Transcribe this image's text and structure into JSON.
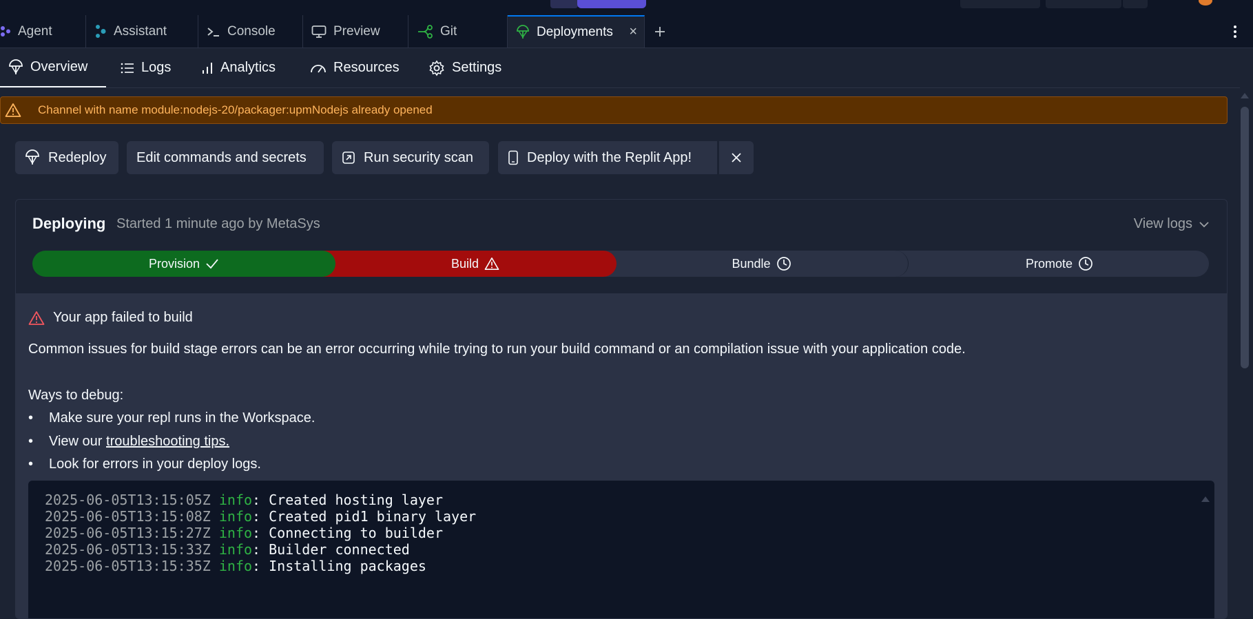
{
  "tabs": [
    {
      "label": "Agent",
      "icon": "agent-icon"
    },
    {
      "label": "Assistant",
      "icon": "assistant-icon"
    },
    {
      "label": "Console",
      "icon": "terminal-icon"
    },
    {
      "label": "Preview",
      "icon": "monitor-icon"
    },
    {
      "label": "Git",
      "icon": "git-icon"
    },
    {
      "label": "Deployments",
      "icon": "deployments-icon",
      "active": true
    }
  ],
  "subnav": [
    {
      "label": "Overview",
      "icon": "deployments-icon",
      "active": true
    },
    {
      "label": "Logs",
      "icon": "list-icon"
    },
    {
      "label": "Analytics",
      "icon": "bar-chart-icon"
    },
    {
      "label": "Resources",
      "icon": "gauge-icon"
    },
    {
      "label": "Settings",
      "icon": "gear-icon"
    }
  ],
  "banner": {
    "message": "Channel with name module:nodejs-20/packager:upmNodejs already opened",
    "color": "#5c3000"
  },
  "actions": {
    "redeploy": "Redeploy",
    "edit": "Edit commands and secrets",
    "scan": "Run security scan",
    "app": "Deploy with the Replit App!"
  },
  "deployment": {
    "status": "Deploying",
    "started": "Started 1 minute ago by MetaSys",
    "view_logs": "View logs",
    "stages": [
      {
        "label": "Provision",
        "state": "success",
        "color": "#0d6b1f"
      },
      {
        "label": "Build",
        "state": "error",
        "color": "#a30c0c"
      },
      {
        "label": "Bundle",
        "state": "pending"
      },
      {
        "label": "Promote",
        "state": "pending"
      }
    ]
  },
  "error": {
    "title": "Your app failed to build",
    "body": "Common issues for build stage errors can be an error occurring while trying to run your build command or an compilation issue with your application code.",
    "ways_title": "Ways to debug:",
    "bullets": {
      "b1": "Make sure your repl runs in the Workspace.",
      "b2_prefix": "View our ",
      "b2_link": "troubleshooting tips.",
      "b3": "Look for errors in your deploy logs."
    }
  },
  "logs": [
    {
      "ts": "2025-06-05T13:15:05Z",
      "level": "info",
      "msg": ": Created hosting layer"
    },
    {
      "ts": "2025-06-05T13:15:08Z",
      "level": "info",
      "msg": ": Created pid1 binary layer"
    },
    {
      "ts": "2025-06-05T13:15:27Z",
      "level": "info",
      "msg": ": Connecting to builder"
    },
    {
      "ts": "2025-06-05T13:15:33Z",
      "level": "info",
      "msg": ": Builder connected"
    },
    {
      "ts": "2025-06-05T13:15:35Z",
      "level": "info",
      "msg": ": Installing packages"
    }
  ]
}
